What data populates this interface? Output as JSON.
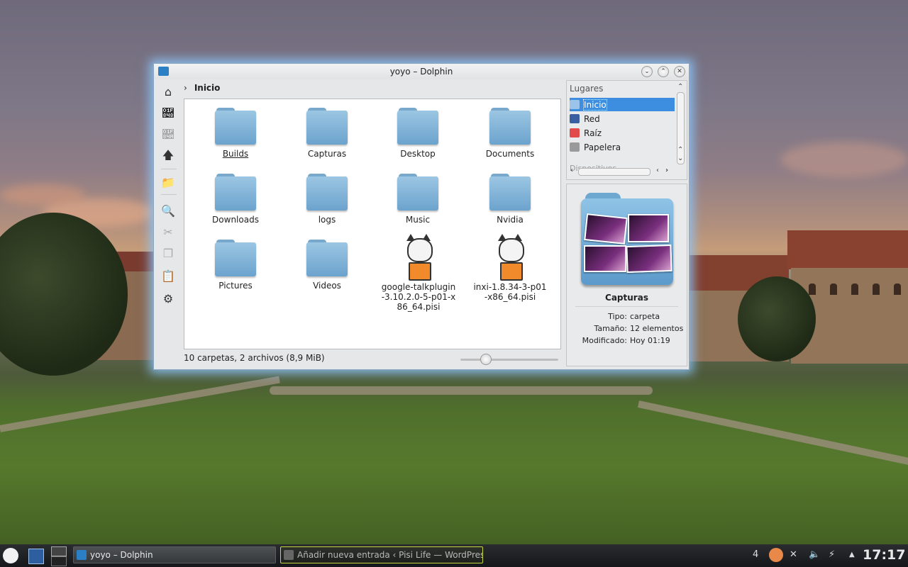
{
  "window": {
    "title": "yoyo – Dolphin",
    "breadcrumb": "Inicio"
  },
  "files": [
    {
      "name": "Builds",
      "kind": "folder"
    },
    {
      "name": "Capturas",
      "kind": "folder"
    },
    {
      "name": "Desktop",
      "kind": "folder"
    },
    {
      "name": "Documents",
      "kind": "folder"
    },
    {
      "name": "Downloads",
      "kind": "folder"
    },
    {
      "name": "logs",
      "kind": "folder"
    },
    {
      "name": "Music",
      "kind": "folder"
    },
    {
      "name": "Nvidia",
      "kind": "folder"
    },
    {
      "name": "Pictures",
      "kind": "folder"
    },
    {
      "name": "Videos",
      "kind": "folder"
    },
    {
      "name": "google-talkplugin-3.10.2.0-5-p01-x86_64.pisi",
      "kind": "package"
    },
    {
      "name": "inxi-1.8.34-3-p01-x86_64.pisi",
      "kind": "package"
    }
  ],
  "status": {
    "summary": "10 carpetas, 2 archivos (8,9 MiB)"
  },
  "places": {
    "title": "Lugares",
    "items": [
      {
        "label": "Inicio",
        "icon": "home-icon",
        "color": "#5b8fd0"
      },
      {
        "label": "Red",
        "icon": "network-icon",
        "color": "#3a5fa0"
      },
      {
        "label": "Raíz",
        "icon": "drive-icon",
        "color": "#e24b4b"
      },
      {
        "label": "Papelera",
        "icon": "trash-icon",
        "color": "#8a8a8a"
      }
    ],
    "next_section": "Dispositivos"
  },
  "info": {
    "name": "Capturas",
    "rows": [
      {
        "key": "Tipo:",
        "value": "carpeta"
      },
      {
        "key": "Tamaño:",
        "value": "12 elementos"
      },
      {
        "key": "Modificado:",
        "value": "Hoy 01:19"
      }
    ]
  },
  "taskbar": {
    "tasks": [
      {
        "label": "yoyo – Dolphin",
        "state": "active"
      },
      {
        "label": "Añadir nueva entrada ‹ Pisi Life — WordPress",
        "state": "attention"
      }
    ],
    "desktop_number": "4",
    "clock": "17:17"
  },
  "colors": {
    "selection": "#3d8de0",
    "folder": "#7fb2d8",
    "window_glow": "#8cc8ff"
  }
}
